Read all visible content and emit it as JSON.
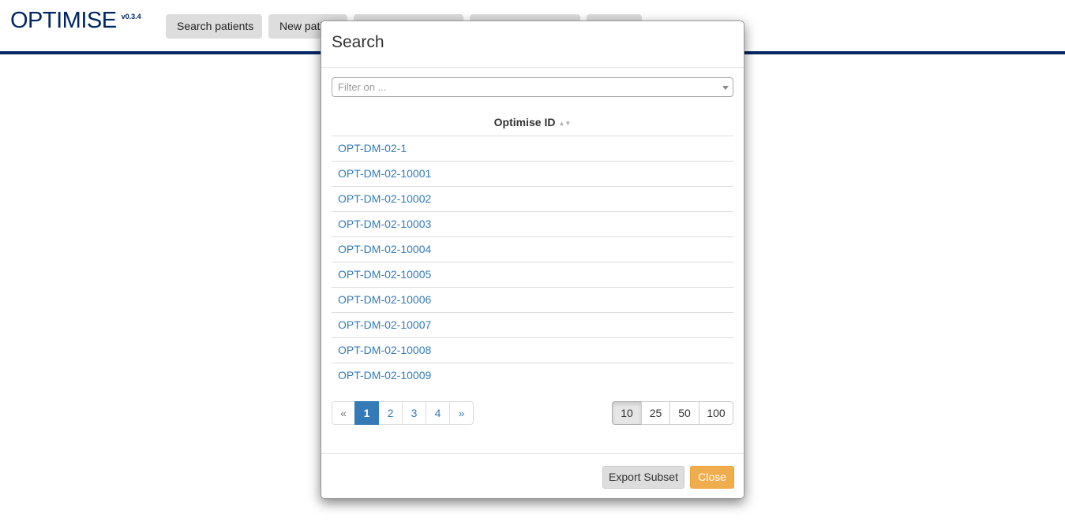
{
  "app": {
    "brand": "OPTIMISE",
    "version": "v0.3.4"
  },
  "nav": {
    "items": [
      {
        "label": "Search patients"
      },
      {
        "label": "New patient"
      },
      {
        "label": ""
      },
      {
        "label": ""
      },
      {
        "label": ""
      }
    ]
  },
  "modal": {
    "title": "Search",
    "filter_placeholder": "Filter on ...",
    "table": {
      "column_header": "Optimise ID",
      "rows": [
        "OPT-DM-02-1",
        "OPT-DM-02-10001",
        "OPT-DM-02-10002",
        "OPT-DM-02-10003",
        "OPT-DM-02-10004",
        "OPT-DM-02-10005",
        "OPT-DM-02-10006",
        "OPT-DM-02-10007",
        "OPT-DM-02-10008",
        "OPT-DM-02-10009"
      ]
    },
    "pagination": {
      "prev": "«",
      "pages": [
        "1",
        "2",
        "3",
        "4"
      ],
      "next": "»",
      "current_page": "1"
    },
    "page_sizes": [
      "10",
      "25",
      "50",
      "100"
    ],
    "selected_page_size": "10",
    "footer": {
      "export_label": "Export Subset",
      "close_label": "Close"
    }
  },
  "colors": {
    "brand": "#002663",
    "link": "#337ab7",
    "warning": "#f0ad4e"
  }
}
